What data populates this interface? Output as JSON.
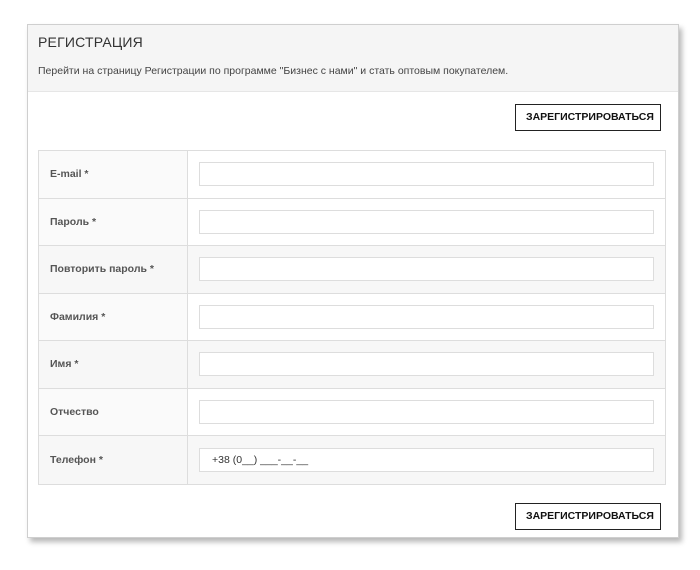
{
  "panel": {
    "title": "РЕГИСТРАЦИЯ",
    "description": "Перейти на страницу Регистрации по программе \"Бизнес с нами\" и стать оптовым покупателем."
  },
  "buttons": {
    "register_top": "ЗАРЕГИСТРИРОВАТЬСЯ",
    "register_bottom": "ЗАРЕГИСТРИРОВАТЬСЯ"
  },
  "form": {
    "fields": [
      {
        "label": "E-mail *",
        "value": ""
      },
      {
        "label": "Пароль *",
        "value": ""
      },
      {
        "label": "Повторить пароль *",
        "value": ""
      },
      {
        "label": "Фамилия *",
        "value": ""
      },
      {
        "label": "Имя *",
        "value": ""
      },
      {
        "label": "Отчество",
        "value": ""
      },
      {
        "label": "Телефон *",
        "value": "+38 (0__) ___-__-__"
      }
    ]
  }
}
